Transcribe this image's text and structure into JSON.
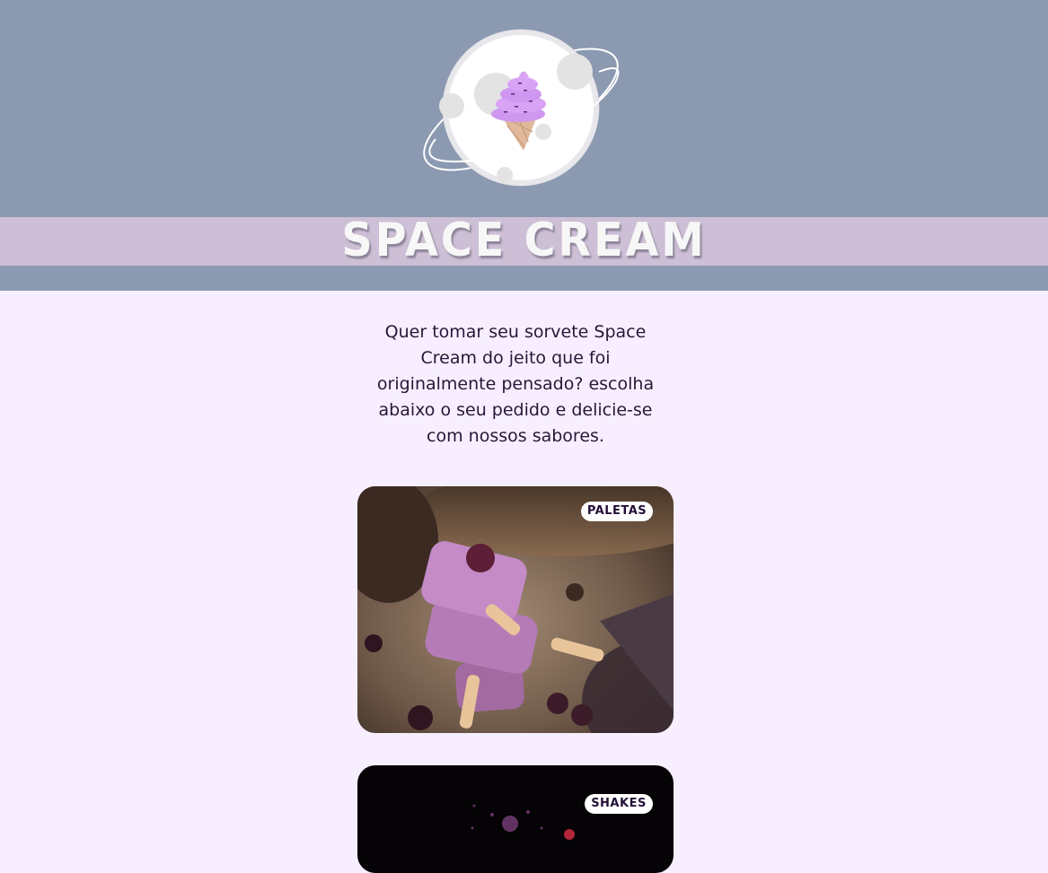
{
  "brand": {
    "name": "SPACE CREAM",
    "logo_icon": "ice-cream-planet-icon",
    "header_color": "#8b99b1",
    "band_color": "#cdbfd5",
    "page_background": "#f7efff",
    "text_color": "#2a1638"
  },
  "intro": {
    "text": "Quer tomar seu sorvete Space Cream do jeito que foi originalmente pensado? escolha abaixo o seu pedido e delicie-se com nossos sabores."
  },
  "categories": [
    {
      "label": "PALETAS",
      "image": "popsicles-photo"
    },
    {
      "label": "SHAKES",
      "image": "shakes-photo"
    }
  ]
}
